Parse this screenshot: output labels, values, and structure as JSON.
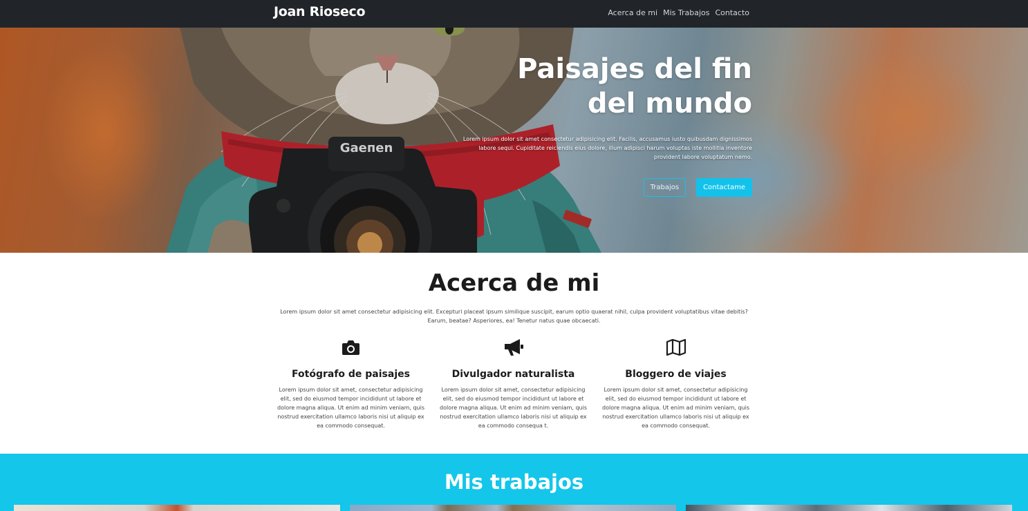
{
  "navbar": {
    "brand": "Joan Rioseco",
    "links": [
      "Acerca de mi",
      "Mis Trabajos",
      "Contacto"
    ]
  },
  "hero": {
    "title_line1": "Paisajes del fin",
    "title_line2": "del mundo",
    "text": "Lorem ipsum dolor sit amet consectetur adipisicing elit. Facilis, accusamus iusto quibusdam dignissimos labore sequi. Cupiditate reiciendis eius dolore, illum adipisci harum voluptas iste mollitia inventore provident labore voluptatum nemo.",
    "camera_brand": "Gaeпen",
    "buttons": {
      "works": "Trabajos",
      "contact": "Contactame"
    }
  },
  "about": {
    "title": "Acerca de mi",
    "text": "Lorem ipsum dolor sit amet consectetur adipisicing elit. Excepturi placeat ipsum similique suscipit, earum optio quaerat nihil, culpa provident voluptatibus vitae debitis? Earum, beatae? Asperiores, ea! Tenetur natus quae obcaecati.",
    "features": [
      {
        "icon": "camera-icon",
        "title": "Fotógrafo de paisajes",
        "text": "Lorem ipsum dolor sit amet, consectetur adipisicing elit, sed do eiusmod tempor incididunt ut labore et dolore magna aliqua. Ut enim ad minim veniam, quis nostrud exercitation ullamco laboris nisi ut aliquip ex ea commodo consequat."
      },
      {
        "icon": "megaphone-icon",
        "title": "Divulgador naturalista",
        "text": "Lorem ipsum dolor sit amet, consectetur adipisicing elit, sed do eiusmod tempor incididunt ut labore et dolore magna aliqua. Ut enim ad minim veniam, quis nostrud exercitation ullamco laboris nisi ut aliquip ex ea commodo consequa t."
      },
      {
        "icon": "map-icon",
        "title": "Bloggero de viajes",
        "text": "Lorem ipsum dolor sit amet, consectetur adipisicing elit, sed do eiusmod tempor incididunt ut labore et dolore magna aliqua. Ut enim ad minim veniam, quis nostrud exercitation ullamco laboris nisi ut aliquip ex ea commodo consequat."
      }
    ]
  },
  "works": {
    "title": "Mis trabajos"
  },
  "colors": {
    "navbar_bg": "#212529",
    "accent": "#13c2ea",
    "works_bg": "#13c6ea"
  }
}
